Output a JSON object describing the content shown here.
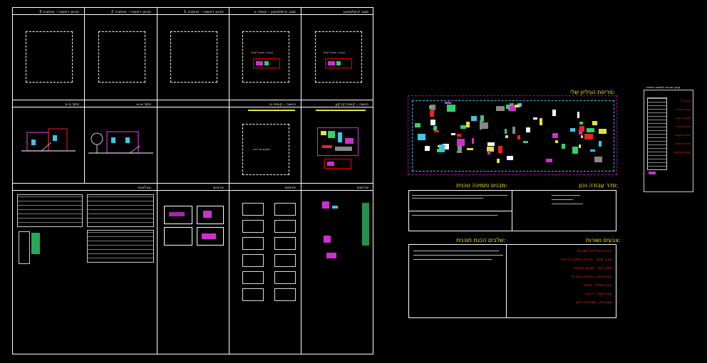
{
  "left_sheet": {
    "row1_titles": [
      "תכנון ראשוני - אופציה 3",
      "תכנון ראשוני - אופציה 2",
      "תכנון ראשוני - אופציה 1",
      "מצב קיים/מוצע - קומה א",
      "מצב קיים/מוצע"
    ],
    "row2_titles": [
      "חתך ב-ב",
      "חתך א-א",
      "",
      "הגשה - קומת גג",
      "הגשה - קומת קרקע"
    ],
    "row3_titles": [
      "טבלאות",
      "פרטים",
      "חזיתות",
      "פריסות"
    ],
    "note_top": "הערה: מבנה קיים",
    "note_mid": "מיקום מדרגות"
  },
  "right_panel": {
    "title_top": "פריסת הגיליון שלי:",
    "work_title_right": "סדר עבודה נכון:",
    "work_title_left": "מבנים ותמיכה טכנית:",
    "colors_title_right": "צבעים ושורות:",
    "colors_title_left": "שלבים הכנת תוכנית:",
    "red_notes": [
      "הנחיות כלליות לשכבות",
      "צבע אדום - קירות קיימים להריסה",
      "צבע ירוק - קירות חדשים",
      "צבע צהוב - טקסט והערות",
      "צבע תכלת - מידות",
      "צבע סגול - ריהוט",
      "צבע לבן - מסגרות גיליון"
    ],
    "side_title": "קובץ שכבות לשימוש המשרד",
    "side_red": [
      "שכבה 0",
      "שכבת קירות",
      "שכבת ריהוט",
      "שכבת מידות",
      "שכבת טקסט",
      "שכבת חתכים",
      "שכבת חזיתות"
    ]
  },
  "colors": {
    "background": "#000000",
    "frame": "#ffffff",
    "accent_purple": "#b000b0",
    "accent_yellow": "#ffe600",
    "accent_red": "#ff2020",
    "accent_green": "#2fd26a"
  }
}
